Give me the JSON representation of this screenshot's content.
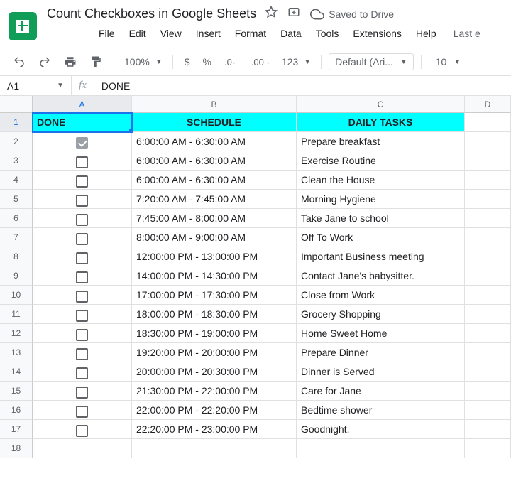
{
  "doc": {
    "title": "Count Checkboxes in Google Sheets",
    "saved": "Saved to Drive"
  },
  "menu": {
    "file": "File",
    "edit": "Edit",
    "view": "View",
    "insert": "Insert",
    "format": "Format",
    "data": "Data",
    "tools": "Tools",
    "extensions": "Extensions",
    "help": "Help",
    "last": "Last e"
  },
  "toolbar": {
    "zoom": "100%",
    "currency": "$",
    "percent": "%",
    "more_fmt": "123",
    "font": "Default (Ari...",
    "font_size": "10"
  },
  "fx": {
    "namebox": "A1",
    "symbol": "fx",
    "value": "DONE"
  },
  "cols": [
    "A",
    "B",
    "C",
    "D"
  ],
  "headers": {
    "a": "DONE",
    "b": "SCHEDULE",
    "c": "DAILY TASKS"
  },
  "rows": [
    {
      "n": 2,
      "done": true,
      "schedule": "6:00:00 AM - 6:30:00 AM",
      "task": "Prepare breakfast"
    },
    {
      "n": 3,
      "done": false,
      "schedule": "6:00:00 AM - 6:30:00 AM",
      "task": "Exercise Routine"
    },
    {
      "n": 4,
      "done": false,
      "schedule": "6:00:00 AM - 6:30:00 AM",
      "task": "Clean the House"
    },
    {
      "n": 5,
      "done": false,
      "schedule": "7:20:00 AM - 7:45:00 AM",
      "task": "Morning Hygiene"
    },
    {
      "n": 6,
      "done": false,
      "schedule": "7:45:00 AM - 8:00:00 AM",
      "task": "Take Jane to school"
    },
    {
      "n": 7,
      "done": false,
      "schedule": "8:00:00 AM - 9:00:00 AM",
      "task": "Off To Work"
    },
    {
      "n": 8,
      "done": false,
      "schedule": "12:00:00 PM - 13:00:00 PM",
      "task": "Important Business meeting"
    },
    {
      "n": 9,
      "done": false,
      "schedule": "14:00:00 PM - 14:30:00 PM",
      "task": "Contact Jane's babysitter."
    },
    {
      "n": 10,
      "done": false,
      "schedule": "17:00:00 PM - 17:30:00 PM",
      "task": "Close from Work"
    },
    {
      "n": 11,
      "done": false,
      "schedule": "18:00:00 PM - 18:30:00 PM",
      "task": "Grocery Shopping"
    },
    {
      "n": 12,
      "done": false,
      "schedule": "18:30:00 PM - 19:00:00 PM",
      "task": "Home Sweet Home"
    },
    {
      "n": 13,
      "done": false,
      "schedule": "19:20:00 PM - 20:00:00 PM",
      "task": "Prepare Dinner"
    },
    {
      "n": 14,
      "done": false,
      "schedule": "20:00:00 PM - 20:30:00 PM",
      "task": "Dinner is Served"
    },
    {
      "n": 15,
      "done": false,
      "schedule": "21:30:00 PM - 22:00:00 PM",
      "task": "Care for Jane"
    },
    {
      "n": 16,
      "done": false,
      "schedule": "22:00:00 PM - 22:20:00 PM",
      "task": "Bedtime shower"
    },
    {
      "n": 17,
      "done": false,
      "schedule": "22:20:00 PM - 23:00:00 PM",
      "task": "Goodnight."
    }
  ],
  "empty_rows": [
    18
  ]
}
